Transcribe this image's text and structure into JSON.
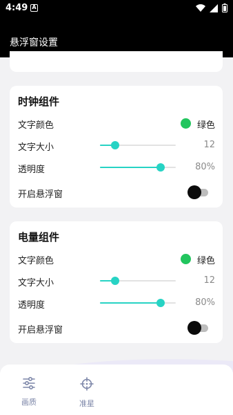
{
  "status_bar": {
    "time": "4:49",
    "notif_glyph": "A",
    "icons": [
      "wifi-icon",
      "signal-icon",
      "battery-icon"
    ]
  },
  "app_bar": {
    "title": "悬浮窗设置"
  },
  "colors": {
    "accent": "#27d3c4",
    "green": "#22c55e",
    "knob": "#0b0b0b"
  },
  "cards": [
    {
      "title": "时钟组件",
      "text_color": {
        "label": "文字颜色",
        "value": "绿色"
      },
      "text_size": {
        "label": "文字大小",
        "value": "12",
        "fraction": 0.2
      },
      "opacity": {
        "label": "透明度",
        "value": "80%",
        "fraction": 0.8
      },
      "float_window": {
        "label": "开启悬浮窗",
        "enabled": false
      }
    },
    {
      "title": "电量组件",
      "text_color": {
        "label": "文字颜色",
        "value": "绿色"
      },
      "text_size": {
        "label": "文字大小",
        "value": "12",
        "fraction": 0.2
      },
      "opacity": {
        "label": "透明度",
        "value": "80%",
        "fraction": 0.8
      },
      "float_window": {
        "label": "开启悬浮窗",
        "enabled": false
      }
    }
  ],
  "bottom_nav": [
    {
      "label": "画质",
      "icon": "sliders-icon"
    },
    {
      "label": "准星",
      "icon": "crosshair-icon"
    }
  ]
}
